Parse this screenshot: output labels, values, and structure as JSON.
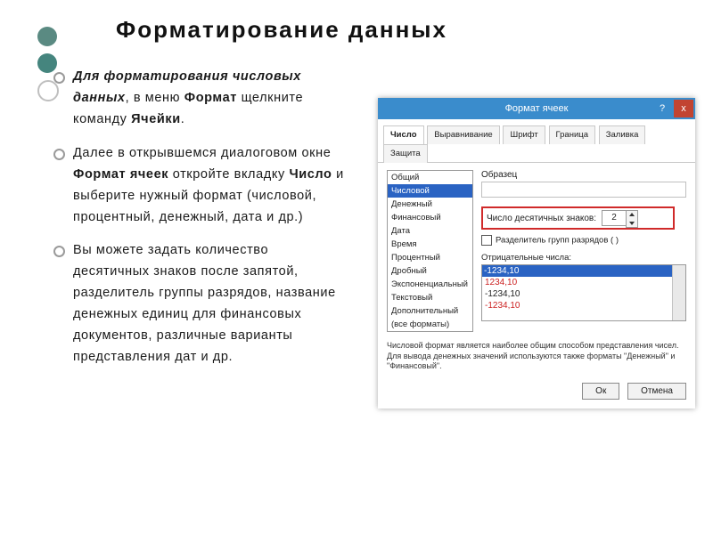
{
  "title": "Форматирование  данных",
  "bullets": {
    "b1_pre": "Для  форматирования  числовых данных",
    "b1_mid": ",  в  меню ",
    "b1_fmt": "Формат",
    "b1_mid2": "  щелкните команду ",
    "b1_cells": "Ячейки",
    "b1_end": ".",
    "b2_a": "Далее  в  открывшемся  диалоговом окне ",
    "b2_b": "Формат  ячеек",
    "b2_c": "  откройте вкладку ",
    "b2_d": "Число",
    "b2_e": "  и  выберите  нужный формат  (числовой,  процентный, денежный,  дата  и  др.)",
    "b3": "Вы  можете  задать  количество десятичных  знаков  после  запятой, разделитель  группы  разрядов, название  денежных  единиц  для финансовых  документов,  различные варианты  представления  дат  и  др."
  },
  "dialog": {
    "title": "Формат ячеек",
    "help": "?",
    "close": "x",
    "tabs": [
      "Число",
      "Выравнивание",
      "Шрифт",
      "Граница",
      "Заливка",
      "Защита"
    ],
    "active_tab": 0,
    "categories": [
      "Общий",
      "Числовой",
      "Денежный",
      "Финансовый",
      "Дата",
      "Время",
      "Процентный",
      "Дробный",
      "Экспоненциальный",
      "Текстовый",
      "Дополнительный",
      "(все форматы)"
    ],
    "selected_category": 1,
    "sample_label": "Образец",
    "decimals_label": "Число десятичных знаков:",
    "decimals_value": "2",
    "thousands_label": "Разделитель групп разрядов ( )",
    "negative_label": "Отрицательные числа:",
    "negatives": [
      "-1234,10",
      "1234,10",
      "-1234,10",
      "-1234,10"
    ],
    "hint": "Числовой формат является наиболее общим способом представления чисел. Для вывода денежных значений используются также форматы \"Денежный\" и \"Финансовый\".",
    "ok": "Ок",
    "cancel": "Отмена"
  }
}
